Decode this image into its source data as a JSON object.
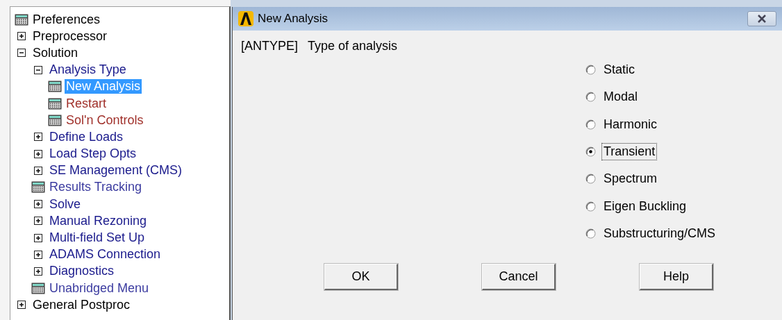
{
  "tree": {
    "items": [
      {
        "kind": "menu",
        "label": "Preferences",
        "color": "#000000",
        "selected": false
      },
      {
        "kind": "folder",
        "label": "Preprocessor",
        "color": "#000000",
        "expanded": false,
        "selected": false
      },
      {
        "kind": "folder",
        "label": "Solution",
        "color": "#000000",
        "expanded": true,
        "selected": false,
        "children": [
          {
            "kind": "folder",
            "label": "Analysis Type",
            "color": "#1a1a8c",
            "expanded": true,
            "selected": false,
            "children": [
              {
                "kind": "menu",
                "label": "New Analysis",
                "selected": true
              },
              {
                "kind": "menu",
                "label": "Restart",
                "color": "#a0302a",
                "selected": false
              },
              {
                "kind": "menu",
                "label": "Sol'n Controls",
                "color": "#a0302a",
                "selected": false
              }
            ]
          },
          {
            "kind": "folder",
            "label": "Define Loads",
            "color": "#1a1a8c",
            "expanded": false,
            "selected": false
          },
          {
            "kind": "folder",
            "label": "Load Step Opts",
            "color": "#1a1a8c",
            "expanded": false,
            "selected": false
          },
          {
            "kind": "folder",
            "label": "SE Management (CMS)",
            "color": "#1a1a8c",
            "expanded": false,
            "selected": false
          },
          {
            "kind": "menu",
            "label": "Results Tracking",
            "color": "#3c3ca0",
            "selected": false
          },
          {
            "kind": "folder",
            "label": "Solve",
            "color": "#1a1a8c",
            "expanded": false,
            "selected": false
          },
          {
            "kind": "folder",
            "label": "Manual Rezoning",
            "color": "#1a1a8c",
            "expanded": false,
            "selected": false
          },
          {
            "kind": "folder",
            "label": "Multi-field Set Up",
            "color": "#1a1a8c",
            "expanded": false,
            "selected": false
          },
          {
            "kind": "folder",
            "label": "ADAMS Connection",
            "color": "#1a1a8c",
            "expanded": false,
            "selected": false
          },
          {
            "kind": "folder",
            "label": "Diagnostics",
            "color": "#1a1a8c",
            "expanded": false,
            "selected": false
          },
          {
            "kind": "menu",
            "label": "Unabridged Menu",
            "color": "#3c3ca0",
            "selected": false
          }
        ]
      },
      {
        "kind": "folder",
        "label": "General Postproc",
        "color": "#000000",
        "expanded": false,
        "selected": false
      }
    ]
  },
  "dialog": {
    "title": "New Analysis",
    "prompt_code": "[ANTYPE]",
    "prompt": "Type of analysis",
    "options": [
      {
        "label": "Static",
        "selected": false
      },
      {
        "label": "Modal",
        "selected": false
      },
      {
        "label": "Harmonic",
        "selected": false
      },
      {
        "label": "Transient",
        "selected": true
      },
      {
        "label": "Spectrum",
        "selected": false
      },
      {
        "label": "Eigen Buckling",
        "selected": false
      },
      {
        "label": "Substructuring/CMS",
        "selected": false
      }
    ],
    "buttons": [
      "OK",
      "Cancel",
      "Help"
    ]
  }
}
